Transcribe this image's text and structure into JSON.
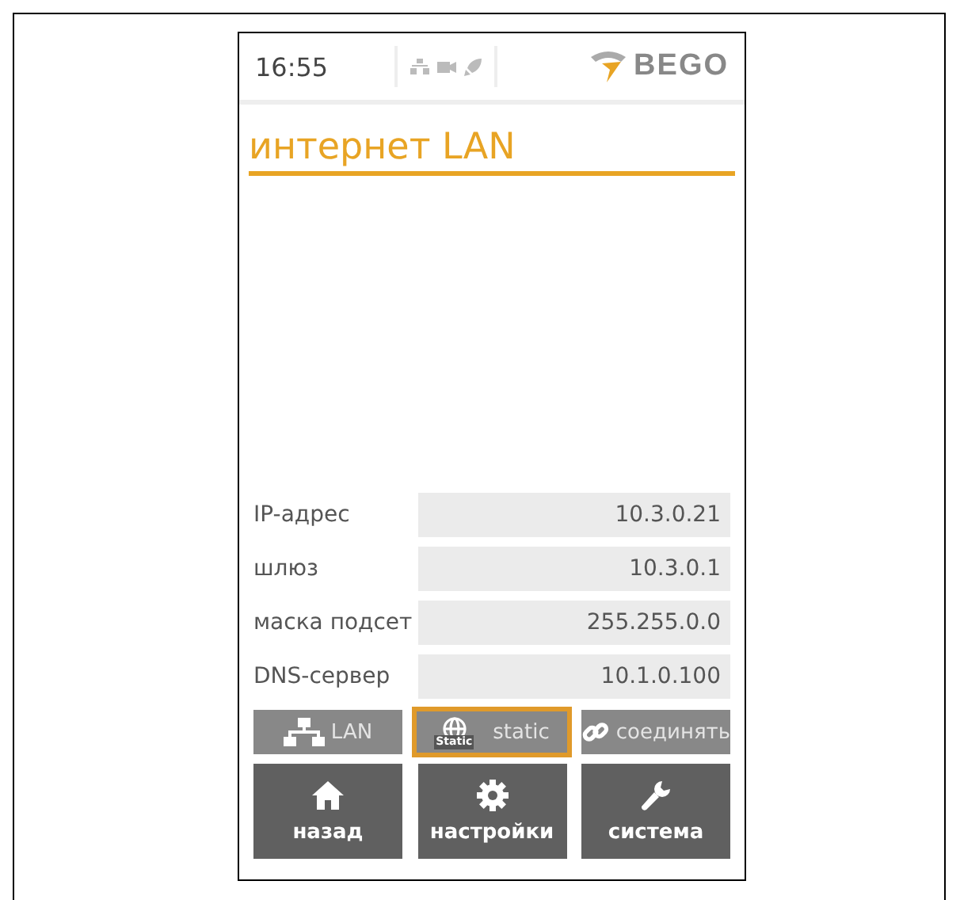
{
  "status_bar": {
    "time": "16:55",
    "logo": "BEGO"
  },
  "title": "интернет LAN",
  "fields": [
    {
      "label": "IP-адрес",
      "value": "10.3.0.21"
    },
    {
      "label": "шлюз",
      "value": "10.3.0.1"
    },
    {
      "label": "маска подсет",
      "value": "255.255.0.0"
    },
    {
      "label": "DNS-сервер",
      "value": "10.1.0.100"
    }
  ],
  "modes": [
    {
      "kind": "network",
      "label": "LAN",
      "selected": false
    },
    {
      "kind": "globe",
      "label": "static",
      "badge": "Static",
      "selected": true
    },
    {
      "kind": "link",
      "label": "соединять",
      "selected": false
    }
  ],
  "nav": [
    {
      "kind": "home",
      "label": "назад"
    },
    {
      "kind": "gear",
      "label": "настройки"
    },
    {
      "kind": "wrench",
      "label": "система"
    }
  ]
}
